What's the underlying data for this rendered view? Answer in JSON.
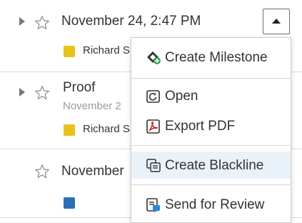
{
  "rows": [
    {
      "title": "November 24, 2:47 PM",
      "chip": "Richard S",
      "chip_color": "#e8c21f"
    },
    {
      "title": "Proof",
      "subtitle": "November 2",
      "chip": "Richard S",
      "chip_color": "#e8c21f"
    },
    {
      "title": "November",
      "chip_color": "#2a6fb5"
    }
  ],
  "menu": {
    "items": [
      {
        "label": "Create Milestone",
        "icon": "milestone-icon"
      },
      {
        "label": "Open",
        "icon": "open-icon"
      },
      {
        "label": "Export PDF",
        "icon": "pdf-icon"
      },
      {
        "label": "Create Blackline",
        "icon": "blackline-icon"
      },
      {
        "label": "Send for Review",
        "icon": "send-review-icon"
      }
    ]
  },
  "colors": {
    "menu_highlight": "#e9f2f9",
    "pdf_red": "#d2232a",
    "review_blue": "#2b8ad8"
  }
}
